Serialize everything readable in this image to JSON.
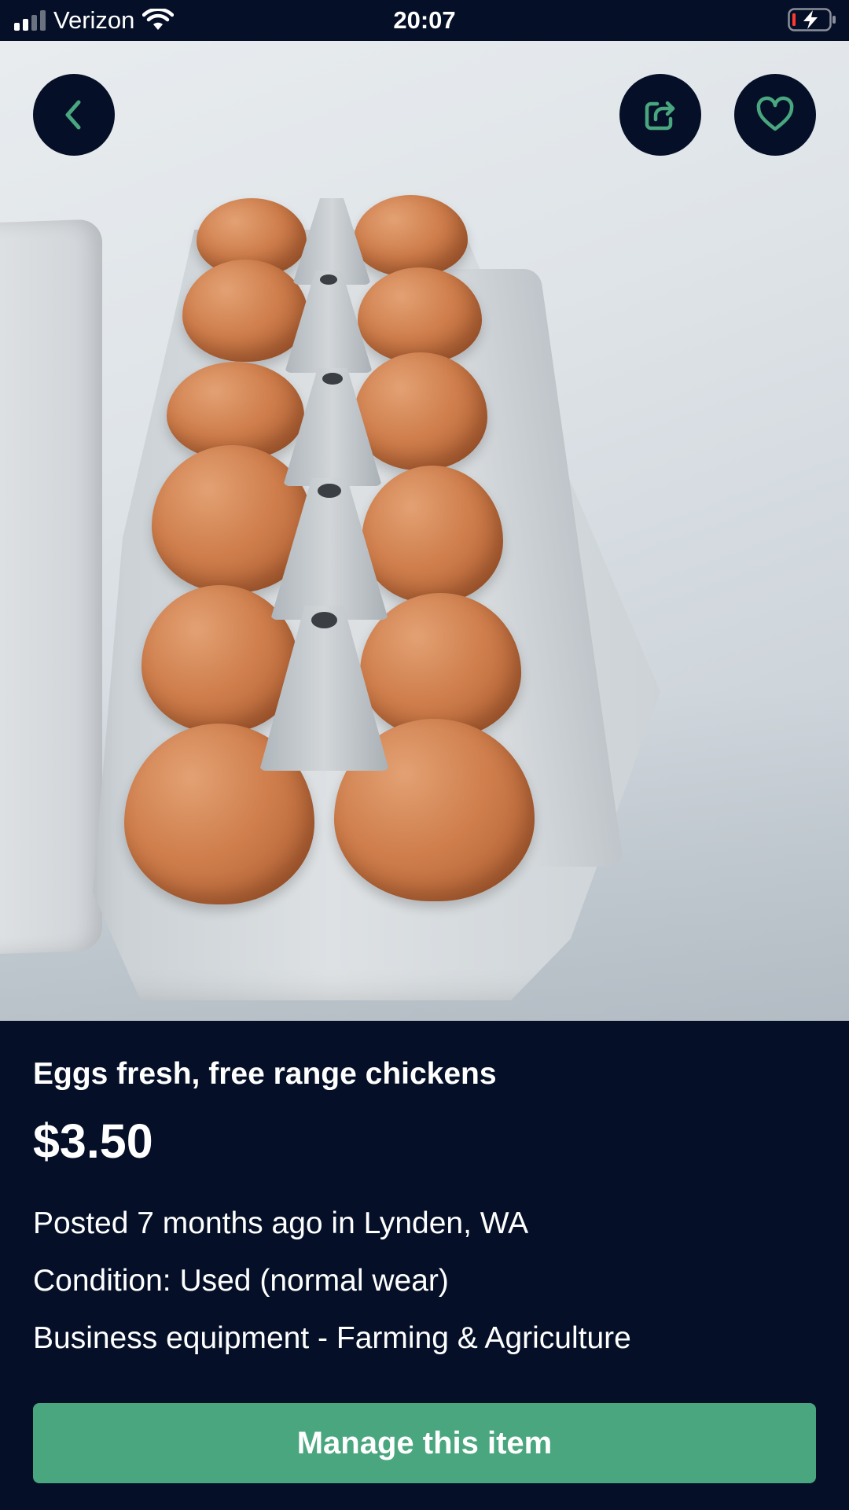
{
  "status_bar": {
    "carrier": "Verizon",
    "time": "20:07",
    "signal_bars_active": 2,
    "signal_bars_total": 4,
    "icons": [
      "signal-icon",
      "wifi-icon",
      "battery-charging-icon"
    ]
  },
  "header": {
    "back_icon": "chevron-left-icon",
    "share_icon": "share-icon",
    "favorite_icon": "heart-icon"
  },
  "listing": {
    "photo": "eggs-in-carton-photo",
    "title": "Eggs fresh, free range chickens",
    "price": "$3.50",
    "posted": "Posted 7 months ago in Lynden, WA",
    "condition": "Condition: Used (normal wear)",
    "category": "Business equipment - Farming & Agriculture"
  },
  "actions": {
    "manage_label": "Manage this item"
  },
  "colors": {
    "background": "#051028",
    "accent": "#4aa67e",
    "icon_accent": "#4aa67e",
    "text": "#ffffff"
  }
}
